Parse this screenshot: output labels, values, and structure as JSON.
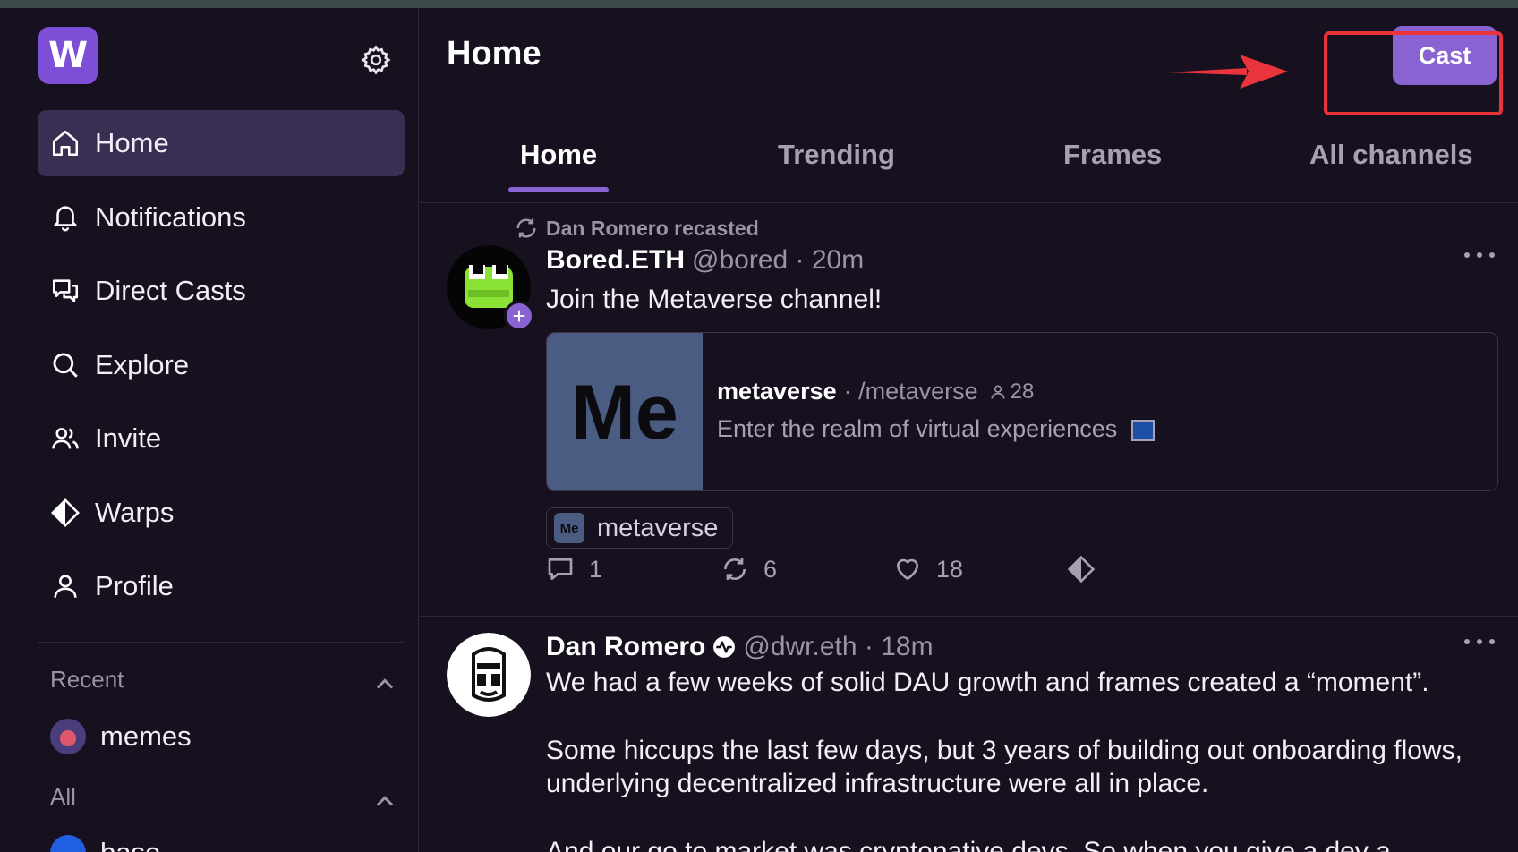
{
  "sidebar": {
    "logo": "W",
    "nav": [
      {
        "label": "Home",
        "icon": "home-icon",
        "active": true
      },
      {
        "label": "Notifications",
        "icon": "bell-icon"
      },
      {
        "label": "Direct Casts",
        "icon": "chat-bubbles-icon"
      },
      {
        "label": "Explore",
        "icon": "search-icon"
      },
      {
        "label": "Invite",
        "icon": "users-icon"
      },
      {
        "label": "Warps",
        "icon": "diamond-icon"
      },
      {
        "label": "Profile",
        "icon": "user-icon"
      }
    ],
    "recent_title": "Recent",
    "recent": [
      {
        "label": "memes"
      }
    ],
    "all_title": "All",
    "all": [
      {
        "label": "base"
      }
    ]
  },
  "header": {
    "title": "Home",
    "cast_button": "Cast"
  },
  "tabs": [
    "Home",
    "Trending",
    "Frames",
    "All channels"
  ],
  "feed": [
    {
      "recast_by": "Dan Romero recasted",
      "author": "Bored.ETH",
      "handle": "@bored · 20m",
      "text": "Join the Metaverse channel!",
      "embed": {
        "thumb_text": "Me",
        "name": "metaverse",
        "meta": "· /metaverse",
        "members": "28",
        "description": "Enter the realm of virtual experiences"
      },
      "channel_chip": {
        "icon_text": "Me",
        "label": "metaverse"
      },
      "replies": "1",
      "recasts": "6",
      "likes": "18"
    },
    {
      "author": "Dan Romero",
      "handle": "@dwr.eth · 18m",
      "paragraphs": [
        "We had a few weeks of solid DAU growth and frames created a “moment”.",
        "Some hiccups the last few days, but 3 years of building out onboarding flows, underlying decentralized infrastructure were all in place.",
        "And our go to market was cryptonative devs. So when you give a dev a"
      ]
    }
  ],
  "colors": {
    "background": "#17101f",
    "accent": "#8a63d2",
    "active_nav": "#3a2f52",
    "annotation_red": "#e8343a"
  }
}
